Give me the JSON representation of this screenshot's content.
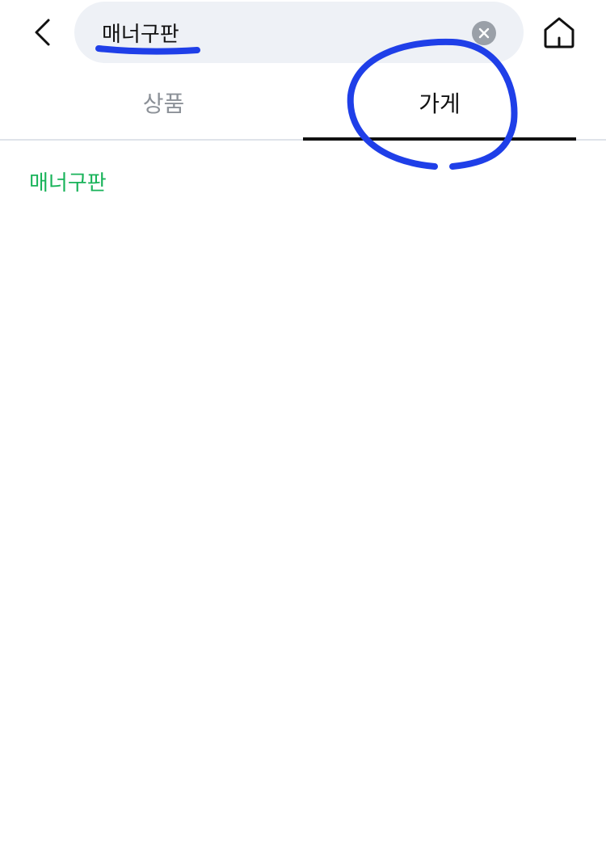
{
  "header": {
    "search": {
      "value": "매너구판",
      "placeholder": ""
    },
    "icons": {
      "back": "chevron-left-icon",
      "clear": "clear-circle-icon",
      "home": "home-icon"
    }
  },
  "tabs": [
    {
      "label": "상품",
      "selected": false
    },
    {
      "label": "가게",
      "selected": true
    }
  ],
  "results": [
    {
      "label": "매너구판"
    }
  ],
  "colors": {
    "search_bg": "#eef1f6",
    "tab_inactive": "#8c9198",
    "tab_active": "#111111",
    "result_text": "#19b35a",
    "annotation": "#1f3fe8"
  }
}
